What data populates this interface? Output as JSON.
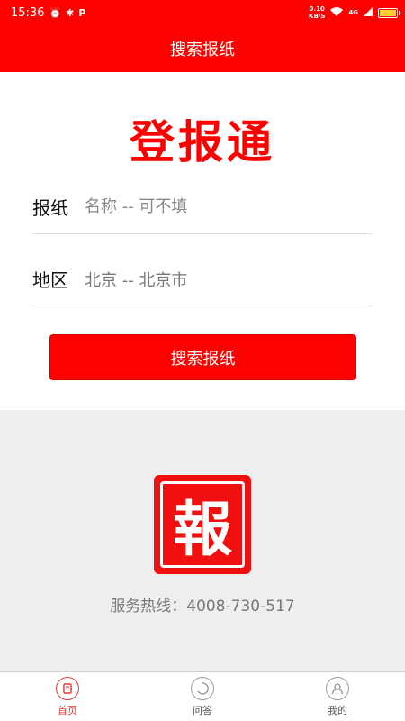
{
  "status_bar": {
    "time": "15:36",
    "net_speed_value": "0.10",
    "net_speed_unit": "KB/S",
    "signal_label": "4G",
    "battery_level": 0.9
  },
  "header": {
    "title": "搜索报纸"
  },
  "brand": {
    "title": "登报通"
  },
  "form": {
    "newspaper": {
      "label": "报纸",
      "placeholder": "名称 -- 可不填"
    },
    "region": {
      "label": "地区",
      "value": "北京 -- 北京市"
    },
    "search_label": "搜索报纸"
  },
  "footer": {
    "seal_char": "報",
    "hotline": "服务热线：4008-730-517"
  },
  "bottom_nav": {
    "items": [
      {
        "label": "首页",
        "icon": "home-icon",
        "active": true
      },
      {
        "label": "问答",
        "icon": "qa-icon",
        "active": false
      },
      {
        "label": "我的",
        "icon": "profile-icon",
        "active": false
      }
    ]
  },
  "colors": {
    "primary": "#fd0000",
    "seal": "#f01010",
    "nav_active": "#e03a3a"
  }
}
